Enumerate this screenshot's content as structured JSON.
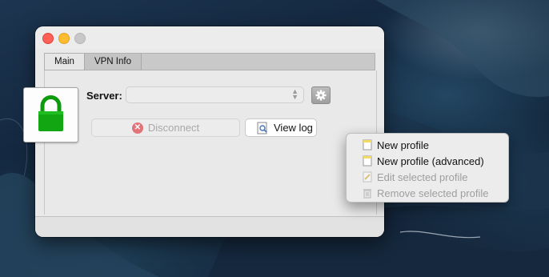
{
  "window": {
    "tabs": [
      {
        "label": "Main",
        "active": true
      },
      {
        "label": "VPN Info",
        "active": false
      }
    ]
  },
  "main": {
    "server_label": "Server:",
    "server_value": "",
    "disconnect_label": "Disconnect",
    "view_log_label": "View log",
    "lock_icon": "green-padlock-icon",
    "status_color": "#1aa31a"
  },
  "profile_menu": {
    "items": [
      {
        "label": "New profile",
        "enabled": true,
        "icon": "new-document-icon"
      },
      {
        "label": "New profile (advanced)",
        "enabled": true,
        "icon": "new-document-icon"
      },
      {
        "label": "Edit selected profile",
        "enabled": false,
        "icon": "edit-document-icon"
      },
      {
        "label": "Remove selected profile",
        "enabled": false,
        "icon": "trash-icon"
      }
    ]
  }
}
